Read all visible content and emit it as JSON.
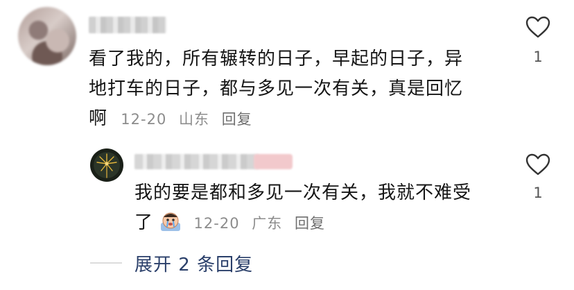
{
  "comment": {
    "author": "",
    "text_line1": "看了我的，所有辗转的日子，早起的日子，异",
    "text_line2": "地打车的日子，都与多见一次有关，真是回忆",
    "text_line3": "啊",
    "date": "12-20",
    "location": "山东",
    "reply_label": "回复",
    "like_count": "1"
  },
  "reply": {
    "author": "",
    "text_line1": "我的要是都和多见一次有关，我就不难受",
    "text_line2": "了",
    "date": "12-20",
    "location": "广东",
    "reply_label": "回复",
    "like_count": "1",
    "sticker": "crying-face-sticker"
  },
  "expand_label": "展开 2 条回复",
  "colors": {
    "text": "#151515",
    "meta": "#8c8c8c",
    "link": "#2a3f6a"
  }
}
